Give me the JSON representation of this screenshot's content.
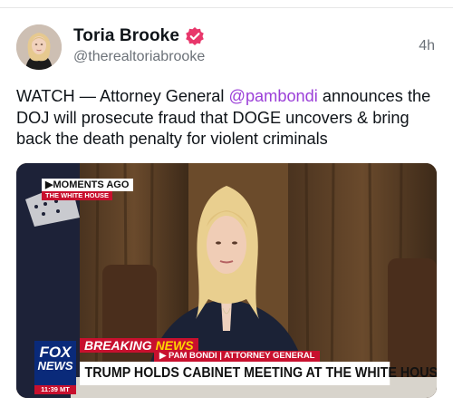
{
  "tweet": {
    "author": {
      "display_name": "Toria Brooke",
      "handle": "@therealtoriabrooke",
      "verified": true,
      "avatar": "profile-photo"
    },
    "time_ago": "4h",
    "text_before": "WATCH — Attorney General ",
    "mention": "@pambondi",
    "text_after": " announces the DOJ will prosecute fraud that DOGE uncovers & bring back the death penalty for violent criminals"
  },
  "media": {
    "type": "video-still",
    "overlay": {
      "moments_ago": "MOMENTS AGO",
      "location_tag": "THE WHITE HOUSE",
      "breaking_a": "BREAKING ",
      "breaking_b": "NEWS",
      "nameplate": "PAM BONDI | ATTORNEY GENERAL",
      "headline": "TRUMP HOLDS CABINET MEETING AT THE WHITE HOUSE",
      "network_top": "FOX",
      "network_bottom": "NEWS",
      "clock": "11:39 MT"
    }
  },
  "colors": {
    "mention": "#9b3fd8",
    "verified_badge": "#e8376b",
    "breaking_red": "#c8102e",
    "breaking_yellow": "#ffd400",
    "fox_blue": "#0a2a7a"
  }
}
